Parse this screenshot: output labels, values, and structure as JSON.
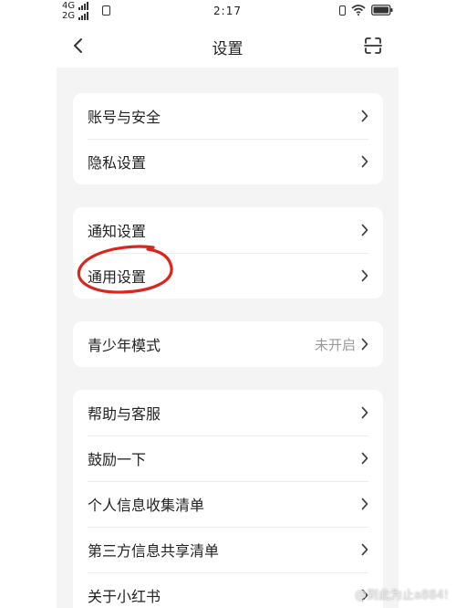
{
  "status_bar": {
    "network_top": "4G",
    "network_bottom": "2G",
    "time": "2:17"
  },
  "nav": {
    "title": "设置",
    "back_icon": "chevron-left-icon",
    "scan_icon": "scan-icon"
  },
  "groups": [
    {
      "items": [
        {
          "label": "账号与安全"
        },
        {
          "label": "隐私设置"
        }
      ]
    },
    {
      "items": [
        {
          "label": "通知设置"
        },
        {
          "label": "通用设置"
        }
      ]
    },
    {
      "items": [
        {
          "label": "青少年模式",
          "value": "未开启"
        }
      ]
    },
    {
      "items": [
        {
          "label": "帮助与客服"
        },
        {
          "label": "鼓励一下"
        },
        {
          "label": "个人信息收集清单"
        },
        {
          "label": "第三方信息共享清单"
        },
        {
          "label": "关于小红书"
        }
      ]
    }
  ],
  "annotation_color": "#d9271f",
  "watermark": "@到此为止a884!"
}
